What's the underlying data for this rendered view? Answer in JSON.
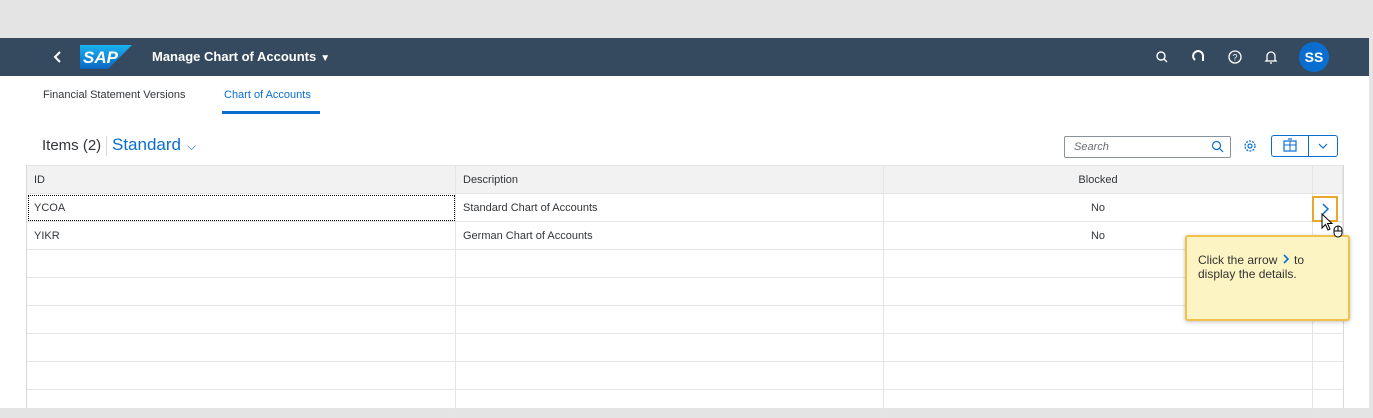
{
  "shell": {
    "logo_text": "SAP",
    "app_title": "Manage Chart of Accounts",
    "avatar_initials": "SS",
    "icons": [
      "back-icon",
      "search-icon",
      "help-icon",
      "info-icon",
      "notification-bell-icon"
    ]
  },
  "tabs": [
    {
      "label": "Financial Statement Versions",
      "selected": false
    },
    {
      "label": "Chart of Accounts",
      "selected": true
    }
  ],
  "toolbar": {
    "items_label": "Items (2)",
    "variant": "Standard",
    "search_placeholder": "Search"
  },
  "table": {
    "columns": [
      "ID",
      "Description",
      "Blocked"
    ],
    "rows": [
      {
        "id": "YCOA",
        "description": "Standard Chart of Accounts",
        "blocked": "No"
      },
      {
        "id": "YIKR",
        "description": "German Chart of Accounts",
        "blocked": "No"
      }
    ]
  },
  "tooltip": {
    "line1": "Click the arrow",
    "line1_end": " to",
    "line2": "display the details."
  },
  "colors": {
    "shell_bg": "#354a5f",
    "accent": "#0a6ed1",
    "tooltip_bg": "#fdf4c3",
    "highlight": "#e9a72e"
  }
}
